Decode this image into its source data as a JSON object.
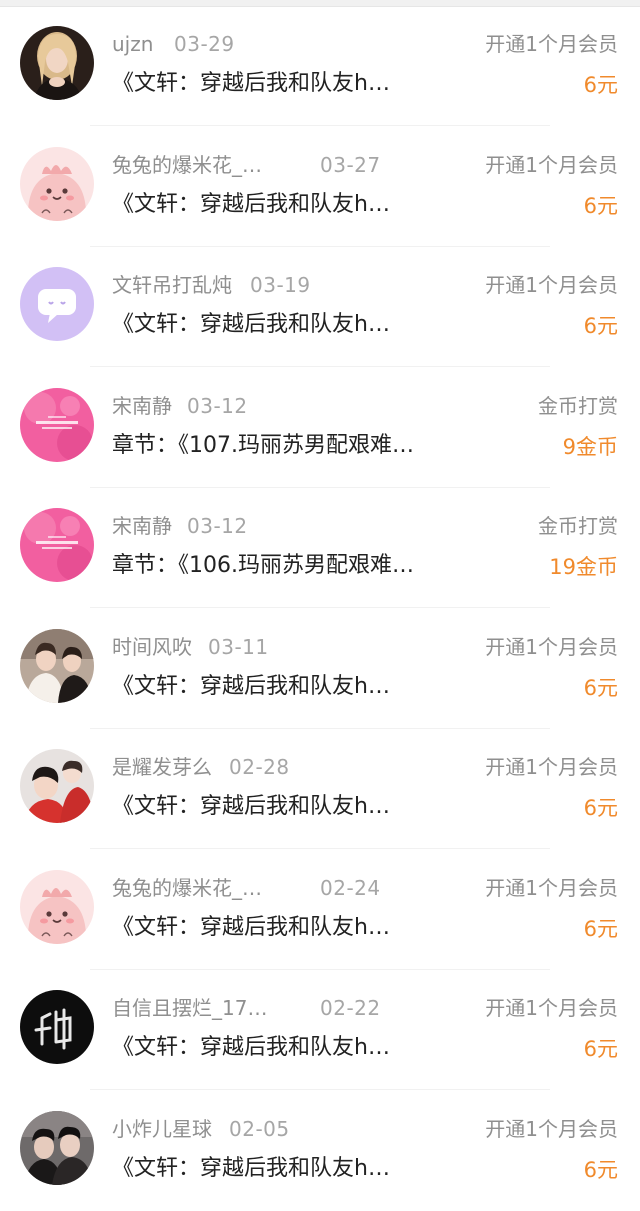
{
  "rows": [
    {
      "avatar": "avatar-blonde-woman",
      "name": "ujzn",
      "date": "03-29",
      "action": "开通1个月会员",
      "title": "《文轩：穿越后我和队友h…",
      "amount": "6元"
    },
    {
      "avatar": "avatar-pink-cartoon",
      "name": "兔兔的爆米花_…",
      "date": "03-27",
      "action": "开通1个月会员",
      "title": "《文轩：穿越后我和队友h…",
      "amount": "6元"
    },
    {
      "avatar": "avatar-purple-chat-bubble",
      "name": "文轩吊打乱炖",
      "date": "03-19",
      "action": "开通1个月会员",
      "title": "《文轩：穿越后我和队友h…",
      "amount": "6元"
    },
    {
      "avatar": "avatar-pink-logo",
      "name": "宋南静",
      "date": "03-12",
      "action": "金币打赏",
      "title": "章节：《107.玛丽苏男配艰难…",
      "amount": "9金币"
    },
    {
      "avatar": "avatar-pink-logo",
      "name": "宋南静",
      "date": "03-12",
      "action": "金币打赏",
      "title": "章节：《106.玛丽苏男配艰难…",
      "amount": "19金币"
    },
    {
      "avatar": "avatar-two-people",
      "name": "时间风吹",
      "date": "03-11",
      "action": "开通1个月会员",
      "title": "《文轩：穿越后我和队友h…",
      "amount": "6元"
    },
    {
      "avatar": "avatar-red-shirt-pair",
      "name": "是耀发芽么",
      "date": "02-28",
      "action": "开通1个月会员",
      "title": "《文轩：穿越后我和队友h…",
      "amount": "6元"
    },
    {
      "avatar": "avatar-pink-cartoon",
      "name": "兔兔的爆米花_…",
      "date": "02-24",
      "action": "开通1个月会员",
      "title": "《文轩：穿越后我和队友h…",
      "amount": "6元"
    },
    {
      "avatar": "avatar-black-calligraphy",
      "name": "自信且摆烂_17…",
      "date": "02-22",
      "action": "开通1个月会员",
      "title": "《文轩：穿越后我和队友h…",
      "amount": "6元"
    },
    {
      "avatar": "avatar-two-people-dark",
      "name": "小炸儿星球",
      "date": "02-05",
      "action": "开通1个月会员",
      "title": "《文轩：穿越后我和队友h…",
      "amount": "6元"
    }
  ],
  "colors": {
    "amount": "#f08a2c",
    "meta": "#8f8f8f",
    "title": "#222222"
  }
}
